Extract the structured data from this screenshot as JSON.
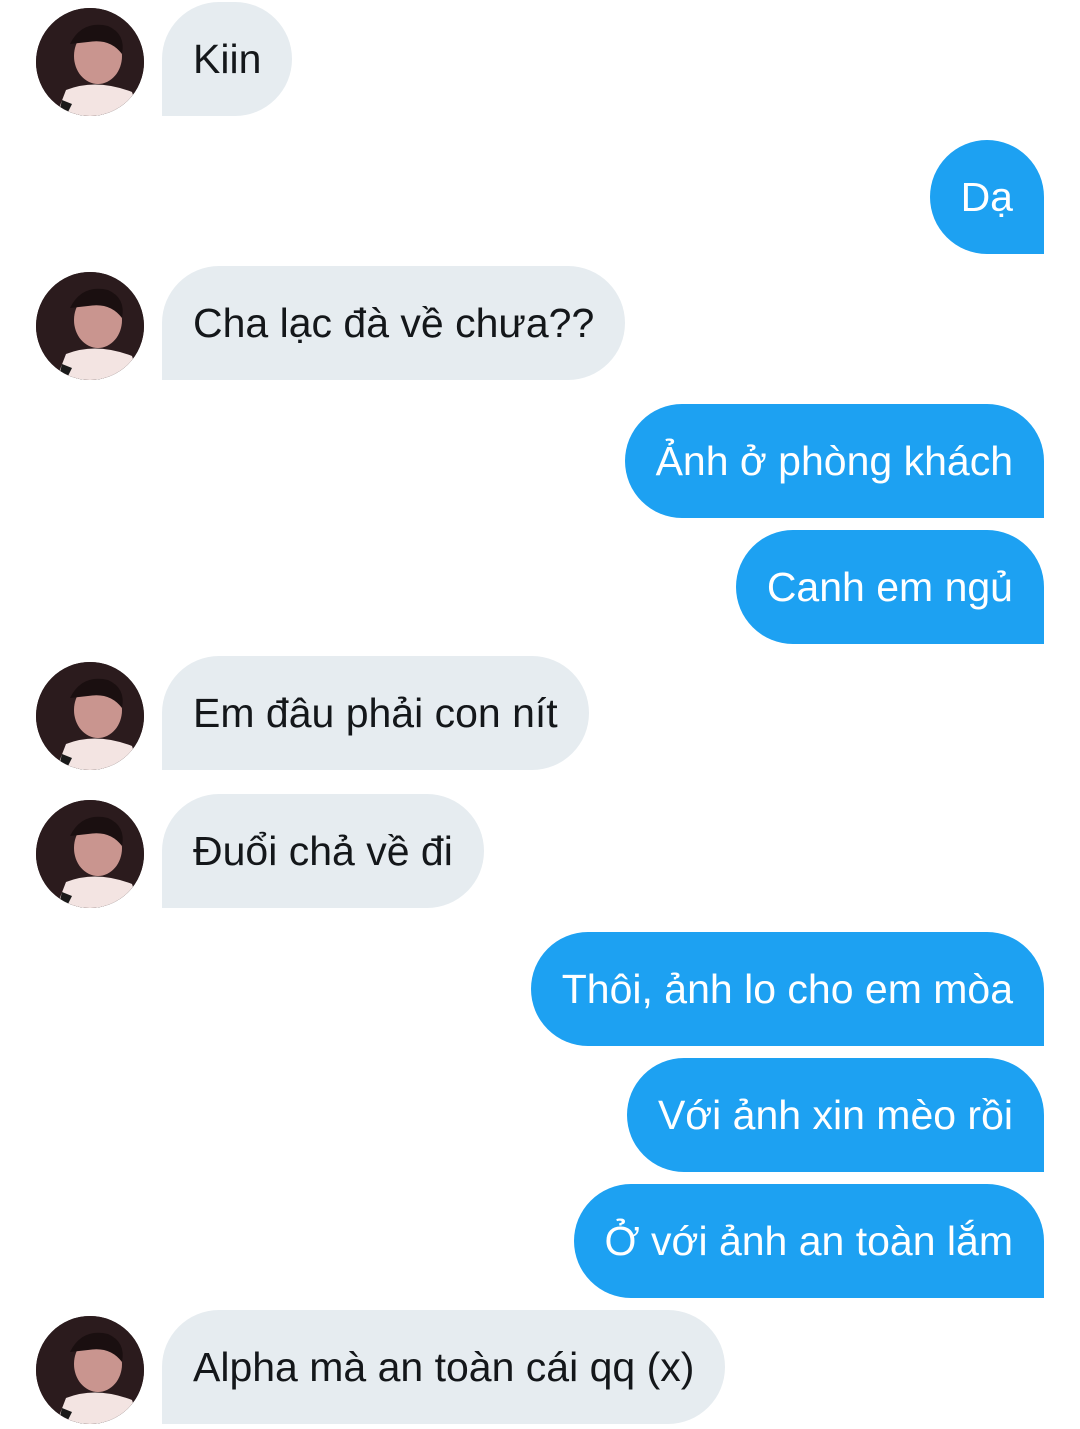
{
  "conversation": {
    "messages": [
      {
        "sender": "them",
        "text": "Kiin"
      },
      {
        "sender": "me",
        "text": "Dạ"
      },
      {
        "sender": "them",
        "text": "Cha lạc đà về chưa??"
      },
      {
        "sender": "me",
        "text": "Ảnh ở phòng khách"
      },
      {
        "sender": "me",
        "text": "Canh em ngủ"
      },
      {
        "sender": "them",
        "text": "Em đâu phải con nít"
      },
      {
        "sender": "them",
        "text": "Đuổi chả về đi"
      },
      {
        "sender": "me",
        "text": "Thôi, ảnh lo cho em mòa"
      },
      {
        "sender": "me",
        "text": "Với ảnh xin mèo rồi"
      },
      {
        "sender": "me",
        "text": "Ở với ảnh an toàn lắm"
      },
      {
        "sender": "them",
        "text": "Alpha mà an toàn cái qq (x)"
      }
    ]
  },
  "colors": {
    "incoming_bubble": "#e6ecf0",
    "incoming_text": "#14171a",
    "outgoing_bubble": "#1da1f2",
    "outgoing_text": "#ffffff"
  }
}
